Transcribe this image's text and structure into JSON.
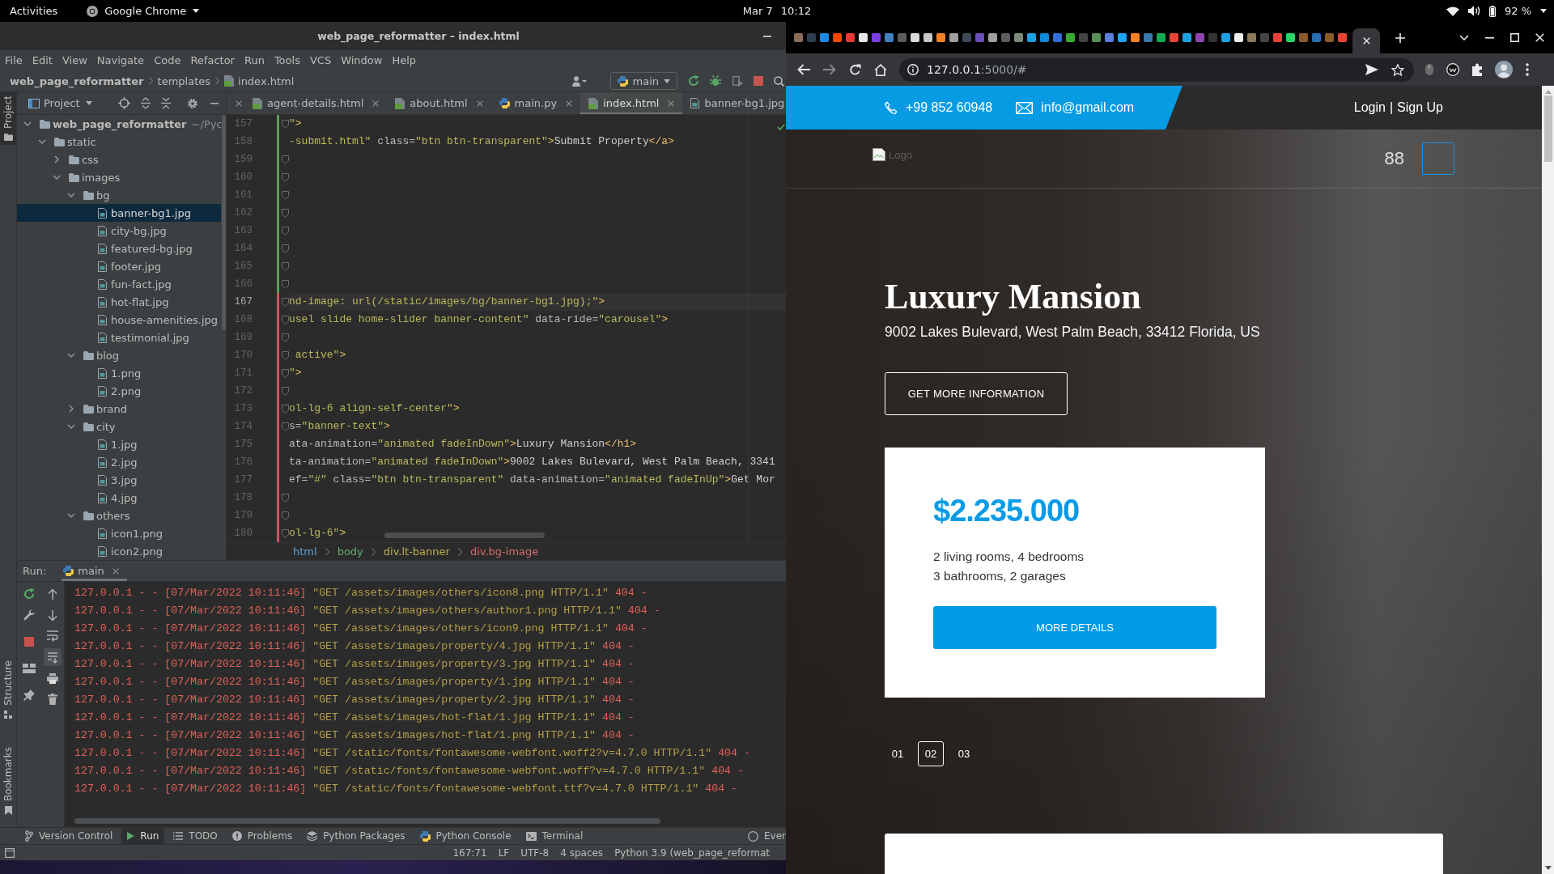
{
  "top_bar": {
    "activities": "Activities",
    "app_menu": "Google Chrome",
    "date": "Mar 7",
    "time": "10:12",
    "battery": "92 %"
  },
  "ide": {
    "title": "web_page_reformatter – index.html",
    "menu": [
      "File",
      "Edit",
      "View",
      "Navigate",
      "Code",
      "Refactor",
      "Run",
      "Tools",
      "VCS",
      "Window",
      "Help"
    ],
    "breadcrumb": [
      {
        "label": "web_page_reformatter",
        "kind": "project"
      },
      {
        "label": "templates",
        "kind": "folder"
      },
      {
        "label": "index.html",
        "kind": "html"
      }
    ],
    "run_config": "main",
    "side_tools": {
      "top": [
        {
          "label": "Project",
          "kind": "project",
          "selected": true
        }
      ],
      "bottom": [
        {
          "label": "Structure",
          "kind": "structure",
          "selected": false
        },
        {
          "label": "Bookmarks",
          "kind": "bookmarks",
          "selected": false
        }
      ]
    },
    "project_panel": {
      "title": "Project",
      "tree": [
        {
          "name": "web_page_reformatter",
          "kind": "folder",
          "hint": "~/Pyc",
          "expanded": true,
          "selected": false,
          "children": [
            {
              "name": "static",
              "kind": "folder",
              "expanded": true,
              "selected": false,
              "children": [
                {
                  "name": "css",
                  "kind": "folder",
                  "expanded": false,
                  "selected": false
                },
                {
                  "name": "images",
                  "kind": "folder",
                  "expanded": true,
                  "selected": false,
                  "children": [
                    {
                      "name": "bg",
                      "kind": "folder",
                      "expanded": true,
                      "selected": false,
                      "children": [
                        {
                          "name": "banner-bg1.jpg",
                          "kind": "image",
                          "selected": true
                        },
                        {
                          "name": "city-bg.jpg",
                          "kind": "image",
                          "selected": false
                        },
                        {
                          "name": "featured-bg.jpg",
                          "kind": "image",
                          "selected": false
                        },
                        {
                          "name": "footer.jpg",
                          "kind": "image",
                          "selected": false
                        },
                        {
                          "name": "fun-fact.jpg",
                          "kind": "image",
                          "selected": false
                        },
                        {
                          "name": "hot-flat.jpg",
                          "kind": "image",
                          "selected": false
                        },
                        {
                          "name": "house-amenities.jpg",
                          "kind": "image",
                          "selected": false
                        },
                        {
                          "name": "testimonial.jpg",
                          "kind": "image",
                          "selected": false
                        }
                      ]
                    },
                    {
                      "name": "blog",
                      "kind": "folder",
                      "expanded": true,
                      "selected": false,
                      "children": [
                        {
                          "name": "1.png",
                          "kind": "image",
                          "selected": false
                        },
                        {
                          "name": "2.png",
                          "kind": "image",
                          "selected": false
                        }
                      ]
                    },
                    {
                      "name": "brand",
                      "kind": "folder",
                      "expanded": false,
                      "selected": false
                    },
                    {
                      "name": "city",
                      "kind": "folder",
                      "expanded": true,
                      "selected": false,
                      "children": [
                        {
                          "name": "1.jpg",
                          "kind": "image",
                          "selected": false
                        },
                        {
                          "name": "2.jpg",
                          "kind": "image",
                          "selected": false
                        },
                        {
                          "name": "3.jpg",
                          "kind": "image",
                          "selected": false
                        },
                        {
                          "name": "4.jpg",
                          "kind": "image",
                          "selected": false
                        }
                      ]
                    },
                    {
                      "name": "others",
                      "kind": "folder",
                      "expanded": true,
                      "selected": false,
                      "children": [
                        {
                          "name": "icon1.png",
                          "kind": "image",
                          "selected": false
                        },
                        {
                          "name": "icon2.png",
                          "kind": "image",
                          "selected": false
                        }
                      ]
                    }
                  ]
                }
              ]
            }
          ]
        }
      ]
    },
    "tabs": [
      {
        "label": "agent-details.html",
        "kind": "html",
        "selected": false
      },
      {
        "label": "about.html",
        "kind": "html",
        "selected": false
      },
      {
        "label": "main.py",
        "kind": "python",
        "selected": false
      },
      {
        "label": "index.html",
        "kind": "html",
        "selected": true
      },
      {
        "label": "banner-bg1.jpg",
        "kind": "image",
        "selected": false
      }
    ],
    "editor": {
      "lines": [
        {
          "number": "157",
          "fold": true,
          "current": false,
          "color": "#5c9e56",
          "code": [
            {
              "kind": "value",
              "text": "\""
            },
            {
              "kind": "tag",
              "text": ">"
            }
          ]
        },
        {
          "number": "158",
          "fold": false,
          "current": false,
          "color": "#5c9e56",
          "code": [
            {
              "kind": "value",
              "text": "-submit.html\""
            },
            {
              "kind": "attr",
              "text": " class="
            },
            {
              "kind": "value",
              "text": "\"btn btn-transparent\""
            },
            {
              "kind": "tag",
              "text": ">"
            },
            {
              "kind": "text",
              "text": "Submit Property"
            },
            {
              "kind": "tag",
              "text": "</a>"
            }
          ]
        },
        {
          "number": "159",
          "fold": true,
          "current": false,
          "color": "#5c9e56"
        },
        {
          "number": "160",
          "fold": true,
          "current": false,
          "color": "#5c9e56"
        },
        {
          "number": "161",
          "fold": true,
          "current": false,
          "color": "#5c9e56"
        },
        {
          "number": "162",
          "fold": true,
          "current": false,
          "color": "#5c9e56"
        },
        {
          "number": "163",
          "fold": true,
          "current": false,
          "color": "#5c9e56"
        },
        {
          "number": "164",
          "fold": true,
          "current": false,
          "color": "#5c9e56"
        },
        {
          "number": "165",
          "fold": true,
          "current": false,
          "color": "#5c9e56"
        },
        {
          "number": "166",
          "fold": true,
          "current": false,
          "color": "#5c9e56"
        },
        {
          "number": "167",
          "fold": true,
          "current": true,
          "color": "#c4575b",
          "code": [
            {
              "kind": "value",
              "text": "nd-image: url(/static/images/bg/banner-bg1.jpg);\""
            },
            {
              "kind": "tag",
              "text": ">"
            }
          ]
        },
        {
          "number": "168",
          "fold": true,
          "current": false,
          "color": "#c4575b",
          "code": [
            {
              "kind": "value",
              "text": "usel slide home-slider banner-content\""
            },
            {
              "kind": "attr",
              "text": " data-ride="
            },
            {
              "kind": "value",
              "text": "\"carousel\""
            },
            {
              "kind": "tag",
              "text": ">"
            }
          ]
        },
        {
          "number": "169",
          "fold": true,
          "current": false,
          "color": "#c4575b"
        },
        {
          "number": "170",
          "fold": true,
          "current": false,
          "color": "#c4575b",
          "code": [
            {
              "kind": "value",
              "text": " active\""
            },
            {
              "kind": "tag",
              "text": ">"
            }
          ]
        },
        {
          "number": "171",
          "fold": true,
          "current": false,
          "color": "#c4575b",
          "code": [
            {
              "kind": "value",
              "text": "\""
            },
            {
              "kind": "tag",
              "text": ">"
            }
          ]
        },
        {
          "number": "172",
          "fold": true,
          "current": false,
          "color": "#c4575b"
        },
        {
          "number": "173",
          "fold": true,
          "current": false,
          "color": "#c4575b",
          "code": [
            {
              "kind": "value",
              "text": "ol-lg-6 align-self-center\""
            },
            {
              "kind": "tag",
              "text": ">"
            }
          ]
        },
        {
          "number": "174",
          "fold": true,
          "current": false,
          "color": "#c4575b",
          "code": [
            {
              "kind": "attr",
              "text": "s="
            },
            {
              "kind": "value",
              "text": "\"banner-text\""
            },
            {
              "kind": "tag",
              "text": ">"
            }
          ]
        },
        {
          "number": "175",
          "fold": false,
          "current": false,
          "color": "#c4575b",
          "code": [
            {
              "kind": "attr",
              "text": "ata-animation="
            },
            {
              "kind": "value",
              "text": "\"animated fadeInDown\""
            },
            {
              "kind": "tag",
              "text": ">"
            },
            {
              "kind": "text",
              "text": "Luxury Mansion"
            },
            {
              "kind": "tag",
              "text": "</h1>"
            }
          ]
        },
        {
          "number": "176",
          "fold": false,
          "current": false,
          "color": "#c4575b",
          "code": [
            {
              "kind": "attr",
              "text": "ta-animation="
            },
            {
              "kind": "value",
              "text": "\"animated fadeInDown\""
            },
            {
              "kind": "tag",
              "text": ">"
            },
            {
              "kind": "text",
              "text": "9002 Lakes Bulevard, West Palm Beach, 3341"
            }
          ]
        },
        {
          "number": "177",
          "fold": false,
          "current": false,
          "color": "#c4575b",
          "code": [
            {
              "kind": "attr",
              "text": "ef="
            },
            {
              "kind": "value",
              "text": "\"#\""
            },
            {
              "kind": "attr",
              "text": " class="
            },
            {
              "kind": "value",
              "text": "\"btn btn-transparent\""
            },
            {
              "kind": "attr",
              "text": " data-animation="
            },
            {
              "kind": "value",
              "text": "\"animated fadeInUp\""
            },
            {
              "kind": "tag",
              "text": ">"
            },
            {
              "kind": "text",
              "text": "Get Mor"
            }
          ]
        },
        {
          "number": "178",
          "fold": true,
          "current": false,
          "color": "#c4575b"
        },
        {
          "number": "179",
          "fold": true,
          "current": false,
          "color": "#c4575b"
        },
        {
          "number": "180",
          "fold": true,
          "current": false,
          "color": "#c4575b",
          "code": [
            {
              "kind": "value",
              "text": "ol-lg-6\""
            },
            {
              "kind": "tag",
              "text": ">"
            }
          ]
        }
      ],
      "path": [
        {
          "label": "html",
          "color": "#5c9fd4"
        },
        {
          "label": "body",
          "color": "#6aab73"
        },
        {
          "label": "div.lt-banner",
          "color": "#b9b34d"
        },
        {
          "label": "div.bg-image",
          "color": "#d16d6d"
        }
      ]
    },
    "run_panel": {
      "label": "Run:",
      "tab": "main",
      "autoscroll": true,
      "log": [
        {
          "client": "127.0.0.1 - - [07/Mar/2022 10:11:46]",
          "request": "\"GET /assets/images/others/icon8.png HTTP/1.1\"",
          "status": "404 -"
        },
        {
          "client": "127.0.0.1 - - [07/Mar/2022 10:11:46]",
          "request": "\"GET /assets/images/others/author1.png HTTP/1.1\"",
          "status": "404 -"
        },
        {
          "client": "127.0.0.1 - - [07/Mar/2022 10:11:46]",
          "request": "\"GET /assets/images/others/icon9.png HTTP/1.1\"",
          "status": "404 -"
        },
        {
          "client": "127.0.0.1 - - [07/Mar/2022 10:11:46]",
          "request": "\"GET /assets/images/property/4.jpg HTTP/1.1\"",
          "status": "404 -"
        },
        {
          "client": "127.0.0.1 - - [07/Mar/2022 10:11:46]",
          "request": "\"GET /assets/images/property/3.jpg HTTP/1.1\"",
          "status": "404 -"
        },
        {
          "client": "127.0.0.1 - - [07/Mar/2022 10:11:46]",
          "request": "\"GET /assets/images/property/1.jpg HTTP/1.1\"",
          "status": "404 -"
        },
        {
          "client": "127.0.0.1 - - [07/Mar/2022 10:11:46]",
          "request": "\"GET /assets/images/property/2.jpg HTTP/1.1\"",
          "status": "404 -"
        },
        {
          "client": "127.0.0.1 - - [07/Mar/2022 10:11:46]",
          "request": "\"GET /assets/images/hot-flat/1.jpg HTTP/1.1\"",
          "status": "404 -"
        },
        {
          "client": "127.0.0.1 - - [07/Mar/2022 10:11:46]",
          "request": "\"GET /assets/images/hot-flat/1.png HTTP/1.1\"",
          "status": "404 -"
        },
        {
          "client": "127.0.0.1 - - [07/Mar/2022 10:11:46]",
          "request": "\"GET /static/fonts/fontawesome-webfont.woff2?v=4.7.0 HTTP/1.1\"",
          "status": "404 -"
        },
        {
          "client": "127.0.0.1 - - [07/Mar/2022 10:11:46]",
          "request": "\"GET /static/fonts/fontawesome-webfont.woff?v=4.7.0 HTTP/1.1\"",
          "status": "404 -"
        },
        {
          "client": "127.0.0.1 - - [07/Mar/2022 10:11:46]",
          "request": "\"GET /static/fonts/fontawesome-webfont.ttf?v=4.7.0 HTTP/1.1\"",
          "status": "404 -"
        }
      ]
    },
    "tool_tabs": {
      "left": [
        {
          "label": "Version Control",
          "kind": "vcs",
          "selected": false
        },
        {
          "label": "Run",
          "kind": "run",
          "selected": true
        },
        {
          "label": "TODO",
          "kind": "todo",
          "selected": false
        },
        {
          "label": "Problems",
          "kind": "problems",
          "selected": false
        },
        {
          "label": "Python Packages",
          "kind": "packages",
          "selected": false
        },
        {
          "label": "Python Console",
          "kind": "console",
          "selected": false
        },
        {
          "label": "Terminal",
          "kind": "terminal",
          "selected": false
        }
      ],
      "right": [
        {
          "label": "Ever",
          "kind": "events",
          "selected": false
        }
      ]
    },
    "status": [
      "167:71",
      "LF",
      "UTF-8",
      "4 spaces",
      "Python 3.9 (web_page_reformat"
    ]
  },
  "browser": {
    "tabs": [
      {
        "color": "#8a6d5b",
        "selected": false
      },
      {
        "color": "#2f3e4e",
        "selected": false
      },
      {
        "color": "#1e88e5",
        "selected": false
      },
      {
        "color": "#ff4500",
        "selected": false
      },
      {
        "color": "#e53935",
        "selected": false
      },
      {
        "color": "#e6e6e6",
        "selected": false
      },
      {
        "color": "#7b3fe4",
        "selected": false
      },
      {
        "color": "#3f7fbf",
        "selected": false
      },
      {
        "color": "#5c5c5c",
        "selected": false
      },
      {
        "color": "#d9d9d9",
        "selected": false
      },
      {
        "color": "#c8c8c8",
        "selected": false
      },
      {
        "color": "#f48024",
        "selected": false
      },
      {
        "color": "#9e9e9e",
        "selected": false
      },
      {
        "color": "#3d4a5a",
        "selected": false
      },
      {
        "color": "#6b4fbb",
        "selected": false
      },
      {
        "color": "#9e9e9e",
        "selected": false
      },
      {
        "color": "#5c5c5c",
        "selected": false
      },
      {
        "color": "#7a8a7a",
        "selected": false
      },
      {
        "color": "#1ba1e2",
        "selected": false
      },
      {
        "color": "#0d8bd8",
        "selected": false
      },
      {
        "color": "#2f6fd6",
        "selected": false
      },
      {
        "color": "#3aa832",
        "selected": false
      },
      {
        "color": "#444444",
        "selected": false
      },
      {
        "color": "#5a8f5a",
        "selected": false
      },
      {
        "color": "#5b7fd8",
        "selected": false
      },
      {
        "color": "#1da1f2",
        "selected": false
      },
      {
        "color": "#f48024",
        "selected": false
      },
      {
        "color": "#3b77a8",
        "selected": false
      },
      {
        "color": "#13aa52",
        "selected": false
      },
      {
        "color": "#ea4335",
        "selected": false
      },
      {
        "color": "#1ba1e2",
        "selected": false
      },
      {
        "color": "#8e44ad",
        "selected": false
      },
      {
        "color": "#333333",
        "selected": false
      },
      {
        "color": "#1ba1e2",
        "selected": false
      },
      {
        "color": "#eeeeee",
        "selected": false
      },
      {
        "color": "#8a7a5a",
        "selected": false
      },
      {
        "color": "#444444",
        "selected": false
      },
      {
        "color": "#ea4335",
        "selected": false
      },
      {
        "color": "#25d366",
        "selected": false
      },
      {
        "color": "#8b5a2b",
        "selected": false
      },
      {
        "color": "#2a6fb0",
        "selected": false
      },
      {
        "color": "#8b5a2b",
        "selected": false
      },
      {
        "color": "#ea4335",
        "selected": false
      },
      {
        "selected": true
      }
    ],
    "url": {
      "host": "127.0.0.1",
      "rest": ":5000/#"
    },
    "page": {
      "contact": {
        "phone": "+99 852 60948",
        "email": "info@gmail.com"
      },
      "auth": {
        "login": "Login",
        "separator": "|",
        "signup": "Sign Up"
      },
      "logo_alt": "Logo",
      "menu_glyph": "88",
      "slide": {
        "title": "Luxury Mansion",
        "address": "9002 Lakes Bulevard, West Palm Beach, 33412 Florida, US",
        "button": "GET MORE INFORMATION"
      },
      "card": {
        "price": "$2.235.000",
        "features": [
          "2 living rooms, 4 bedrooms",
          "3 bathrooms, 2 garages"
        ],
        "button": "MORE DETAILS"
      },
      "pager": [
        {
          "label": "01",
          "selected": false
        },
        {
          "label": "02",
          "selected": true
        },
        {
          "label": "03",
          "selected": false
        }
      ]
    }
  }
}
